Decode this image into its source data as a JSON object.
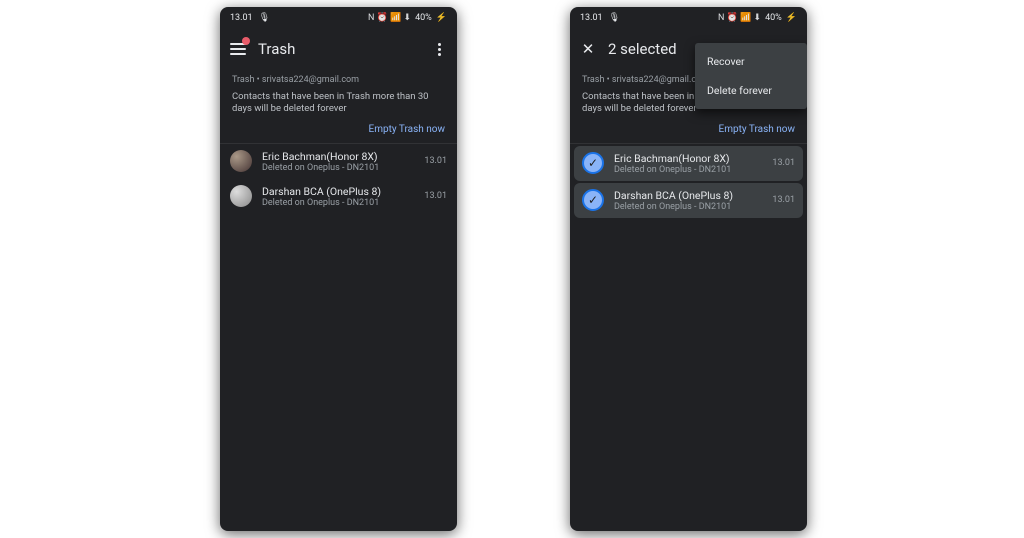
{
  "status": {
    "time": "13.01",
    "battery": "40%",
    "indicators": "N ⏰ 📶 ⬇"
  },
  "left": {
    "title": "Trash",
    "breadcrumb": "Trash • srivatsa224@gmail.com",
    "info": "Contacts that have been in Trash more than 30 days will be deleted forever",
    "empty_label": "Empty Trash now",
    "contacts": [
      {
        "name": "Eric Bachman(Honor 8X)",
        "sub": "Deleted on Oneplus - DN2101",
        "time": "13.01"
      },
      {
        "name": "Darshan BCA (OnePlus 8)",
        "sub": "Deleted on Oneplus - DN2101",
        "time": "13.01"
      }
    ]
  },
  "right": {
    "title": "2 selected",
    "breadcrumb": "Trash • srivatsa224@gmail.com",
    "info": "Contacts that have been in Trash more than 30 days will be deleted forever",
    "empty_label": "Empty Trash now",
    "menu": {
      "recover": "Recover",
      "delete": "Delete forever"
    },
    "contacts": [
      {
        "name": "Eric Bachman(Honor 8X)",
        "sub": "Deleted on Oneplus - DN2101",
        "time": "13.01"
      },
      {
        "name": "Darshan BCA (OnePlus 8)",
        "sub": "Deleted on Oneplus - DN2101",
        "time": "13.01"
      }
    ]
  }
}
